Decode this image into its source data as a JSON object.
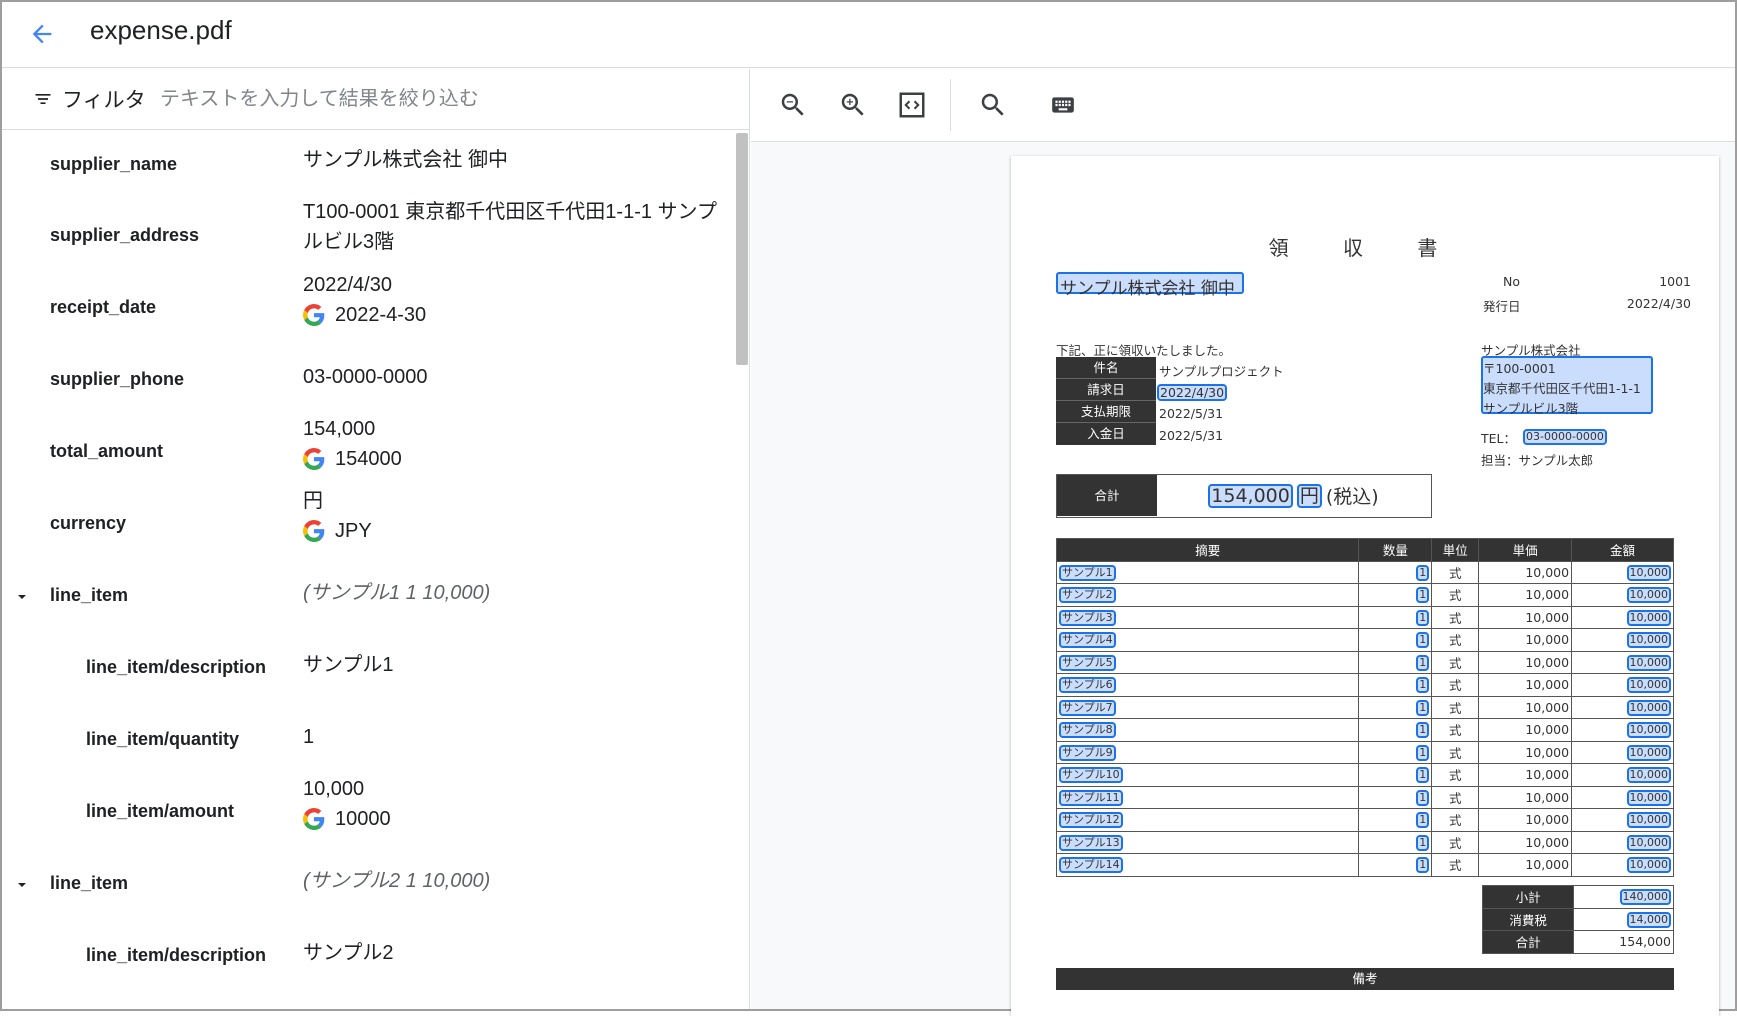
{
  "header": {
    "title": "expense.pdf"
  },
  "filter": {
    "label": "フィルタ",
    "placeholder": "テキストを入力して結果を絞り込む"
  },
  "fields": [
    {
      "key": "supplier_name",
      "value": "サンプル株式会社 御中"
    },
    {
      "key": "supplier_address",
      "value": "T100-0001 東京都千代田区千代田1-1-1 サンプルビル3階"
    },
    {
      "key": "receipt_date",
      "value": "2022/4/30",
      "normalized": "2022-4-30"
    },
    {
      "key": "supplier_phone",
      "value": "03-0000-0000"
    },
    {
      "key": "total_amount",
      "value": "154,000",
      "normalized": "154000"
    },
    {
      "key": "currency",
      "value": "円",
      "normalized": "JPY"
    },
    {
      "key": "line_item",
      "summary": "(サンプル1 1 10,000)"
    },
    {
      "key": "line_item/description",
      "value": "サンプル1"
    },
    {
      "key": "line_item/quantity",
      "value": "1"
    },
    {
      "key": "line_item/amount",
      "value": "10,000",
      "normalized": "10000"
    },
    {
      "key": "line_item",
      "summary": "(サンプル2 1 10,000)"
    },
    {
      "key": "line_item/description",
      "value": "サンプル2"
    }
  ],
  "document": {
    "title": "領 収 書",
    "recipient": "サンプル株式会社 御中",
    "no_label": "No",
    "no_value": "1001",
    "issue_label": "発行日",
    "issue_value": "2022/4/30",
    "received_text": "下記、正に領収いたしました。",
    "info_rows": [
      {
        "label": "件名",
        "value": "サンプルプロジェクト"
      },
      {
        "label": "請求日",
        "value": "2022/4/30"
      },
      {
        "label": "支払期限",
        "value": "2022/5/31"
      },
      {
        "label": "入金日",
        "value": "2022/5/31"
      }
    ],
    "company_name": "サンプル株式会社",
    "company_postal": "〒100-0001",
    "company_address1": "東京都千代田区千代田1-1-1",
    "company_address2": "サンプルビル3階",
    "tel_label": "TEL：",
    "tel_value": "03-0000-0000",
    "contact": "担当：サンプル太郎",
    "total_label": "合計",
    "total_amount": "154,000",
    "total_currency": "円",
    "total_tax": "(税込)",
    "table_headers": [
      "摘要",
      "数量",
      "単位",
      "単価",
      "金額"
    ],
    "items": [
      {
        "desc": "サンプル1",
        "qty": "1",
        "unit": "式",
        "price": "10,000",
        "amount": "10,000"
      },
      {
        "desc": "サンプル2",
        "qty": "1",
        "unit": "式",
        "price": "10,000",
        "amount": "10,000"
      },
      {
        "desc": "サンプル3",
        "qty": "1",
        "unit": "式",
        "price": "10,000",
        "amount": "10,000"
      },
      {
        "desc": "サンプル4",
        "qty": "1",
        "unit": "式",
        "price": "10,000",
        "amount": "10,000"
      },
      {
        "desc": "サンプル5",
        "qty": "1",
        "unit": "式",
        "price": "10,000",
        "amount": "10,000"
      },
      {
        "desc": "サンプル6",
        "qty": "1",
        "unit": "式",
        "price": "10,000",
        "amount": "10,000"
      },
      {
        "desc": "サンプル7",
        "qty": "1",
        "unit": "式",
        "price": "10,000",
        "amount": "10,000"
      },
      {
        "desc": "サンプル8",
        "qty": "1",
        "unit": "式",
        "price": "10,000",
        "amount": "10,000"
      },
      {
        "desc": "サンプル9",
        "qty": "1",
        "unit": "式",
        "price": "10,000",
        "amount": "10,000"
      },
      {
        "desc": "サンプル10",
        "qty": "1",
        "unit": "式",
        "price": "10,000",
        "amount": "10,000"
      },
      {
        "desc": "サンプル11",
        "qty": "1",
        "unit": "式",
        "price": "10,000",
        "amount": "10,000"
      },
      {
        "desc": "サンプル12",
        "qty": "1",
        "unit": "式",
        "price": "10,000",
        "amount": "10,000"
      },
      {
        "desc": "サンプル13",
        "qty": "1",
        "unit": "式",
        "price": "10,000",
        "amount": "10,000"
      },
      {
        "desc": "サンプル14",
        "qty": "1",
        "unit": "式",
        "price": "10,000",
        "amount": "10,000"
      }
    ],
    "subtotal_label": "小計",
    "subtotal_value": "140,000",
    "tax_label": "消費税",
    "tax_value": "14,000",
    "grand_label": "合計",
    "grand_value": "154,000",
    "remarks_label": "備考"
  },
  "colors": {
    "accent": "#1a73e8",
    "dark_cell": "#333333"
  }
}
